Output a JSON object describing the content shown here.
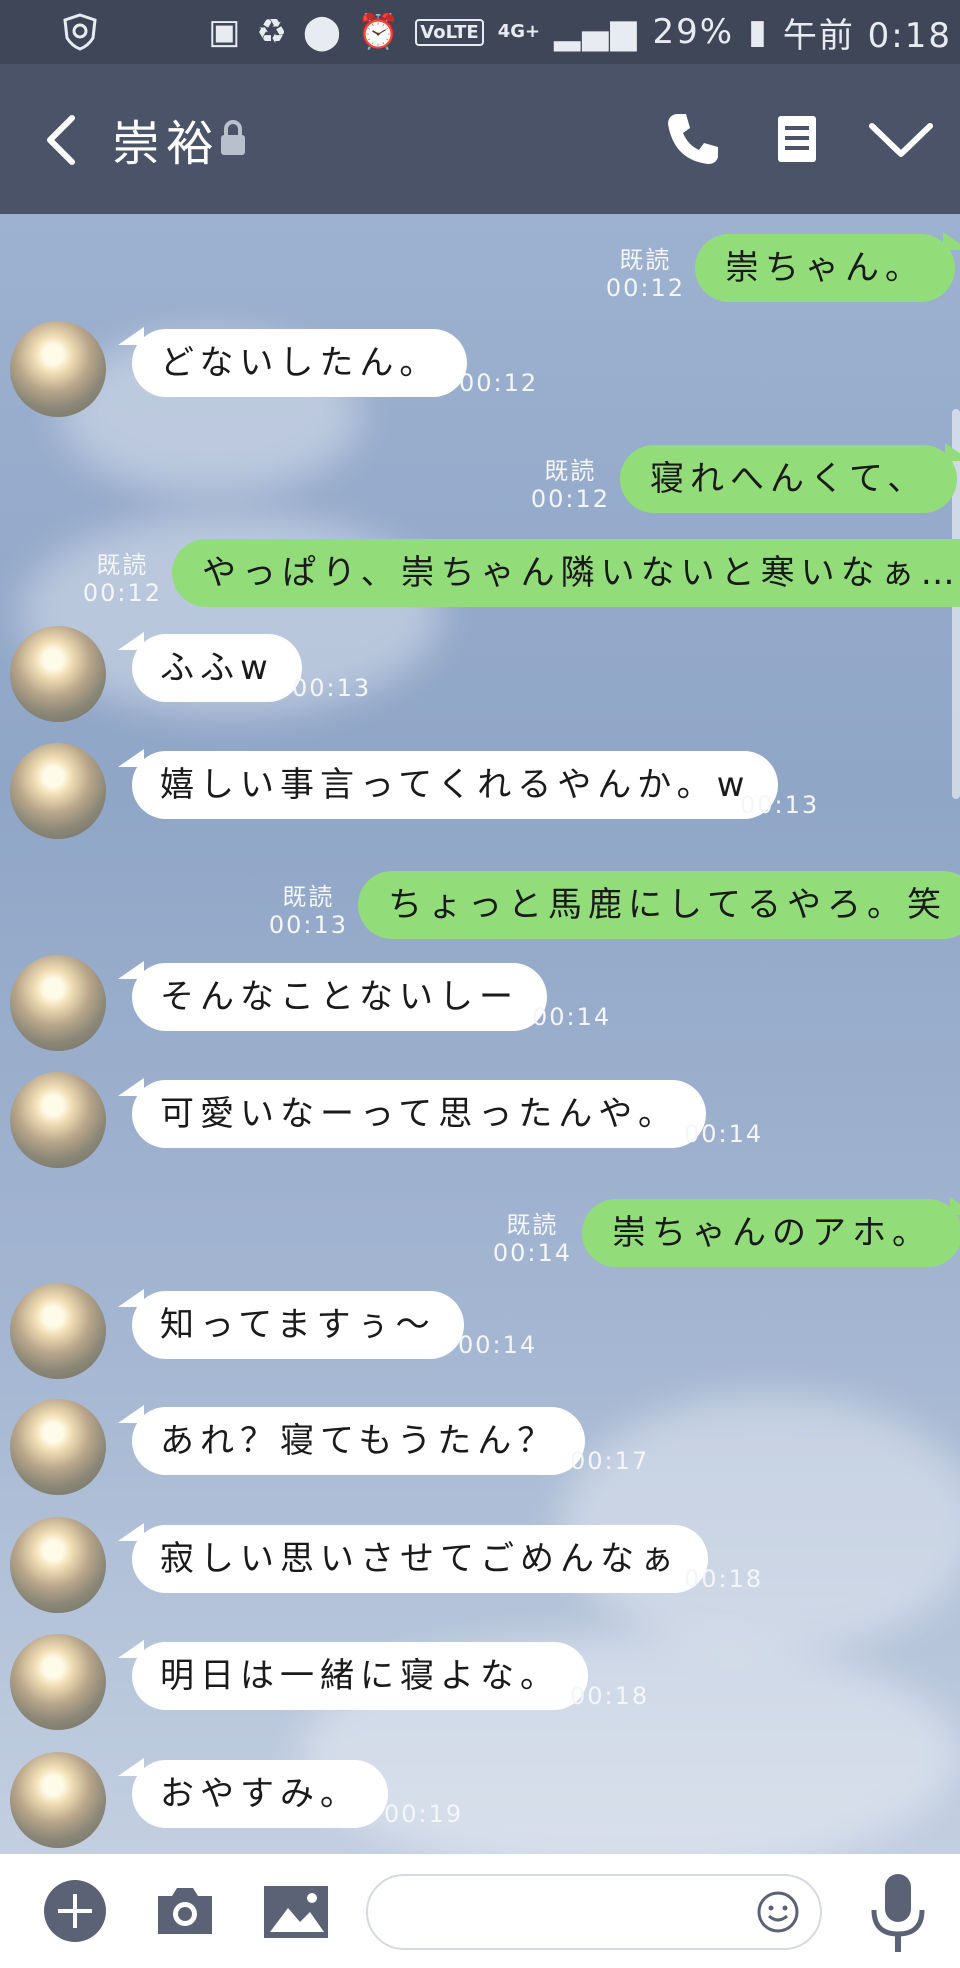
{
  "status_bar": {
    "battery": "29%",
    "time": "午前 0:18",
    "volte": "VoLTE",
    "network": "4G+"
  },
  "header": {
    "title": "崇裕"
  },
  "colors": {
    "outgoing_bubble": "#92dd7a",
    "incoming_bubble": "#ffffff",
    "header_bg": "#4a5368"
  },
  "messages": [
    {
      "side": "out",
      "text": "崇ちゃん。",
      "read": "既読",
      "time": "00:12"
    },
    {
      "side": "in",
      "text": "どないしたん。",
      "time": "00:12"
    },
    {
      "side": "out",
      "text": "寝れへんくて、",
      "read": "既読",
      "time": "00:12"
    },
    {
      "side": "out",
      "text": "やっぱり、崇ちゃん隣いないと寒いなぁ…",
      "read": "既読",
      "time": "00:12"
    },
    {
      "side": "in",
      "text": "ふふw",
      "time": "00:13"
    },
    {
      "side": "in",
      "text": "嬉しい事言ってくれるやんか。w",
      "time": "00:13"
    },
    {
      "side": "out",
      "text": "ちょっと馬鹿にしてるやろ。笑",
      "read": "既読",
      "time": "00:13"
    },
    {
      "side": "in",
      "text": "そんなことないしー",
      "time": "00:14"
    },
    {
      "side": "in",
      "text": "可愛いなーって思ったんや。",
      "time": "00:14"
    },
    {
      "side": "out",
      "text": "崇ちゃんのアホ。",
      "read": "既読",
      "time": "00:14"
    },
    {
      "side": "in",
      "text": "知ってますぅ～",
      "time": "00:14"
    },
    {
      "side": "in",
      "text": "あれ？寝てもうたん？",
      "time": "00:17"
    },
    {
      "side": "in",
      "text": "寂しい思いさせてごめんなぁ",
      "time": "00:18"
    },
    {
      "side": "in",
      "text": "明日は一緒に寝よな。",
      "time": "00:18"
    },
    {
      "side": "in",
      "text": "おやすみ。",
      "time": "00:19"
    }
  ]
}
